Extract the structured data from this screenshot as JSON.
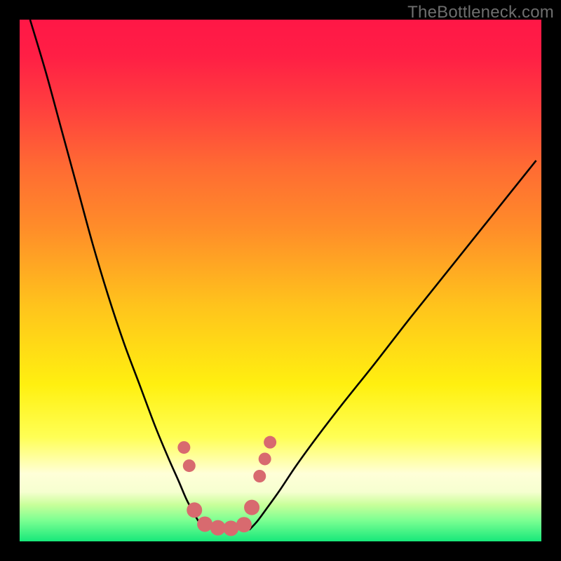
{
  "watermark": {
    "text": "TheBottleneck.com"
  },
  "gradient_stops": [
    {
      "offset": 0.0,
      "color": "#ff1746"
    },
    {
      "offset": 0.07,
      "color": "#ff1f45"
    },
    {
      "offset": 0.16,
      "color": "#ff3c3f"
    },
    {
      "offset": 0.28,
      "color": "#ff6a33"
    },
    {
      "offset": 0.4,
      "color": "#ff8d29"
    },
    {
      "offset": 0.55,
      "color": "#ffc41c"
    },
    {
      "offset": 0.7,
      "color": "#fff010"
    },
    {
      "offset": 0.8,
      "color": "#ffff55"
    },
    {
      "offset": 0.87,
      "color": "#ffffd8"
    },
    {
      "offset": 0.905,
      "color": "#f6ffd0"
    },
    {
      "offset": 0.93,
      "color": "#c8ff9a"
    },
    {
      "offset": 0.96,
      "color": "#7bff92"
    },
    {
      "offset": 1.0,
      "color": "#17e87a"
    }
  ],
  "chart_data": {
    "type": "line",
    "title": "",
    "xlabel": "",
    "ylabel": "",
    "xlim": [
      0,
      100
    ],
    "ylim": [
      0,
      100
    ],
    "series": [
      {
        "name": "left-curve",
        "x": [
          2,
          5,
          8,
          11,
          14,
          17,
          20,
          23,
          26,
          28.5,
          30.5,
          32,
          33.5,
          34.5,
          35.5
        ],
        "y": [
          100,
          90,
          79,
          68,
          57,
          47,
          38,
          30,
          22,
          16,
          11.5,
          8,
          5.2,
          3.5,
          2.2
        ]
      },
      {
        "name": "right-curve",
        "x": [
          44,
          45.5,
          47.5,
          50,
          53,
          57,
          62,
          68,
          75,
          83,
          91,
          99
        ],
        "y": [
          2.2,
          3.8,
          6.5,
          10,
          14.5,
          20,
          26.5,
          34,
          43,
          53,
          63,
          73
        ]
      },
      {
        "name": "markers",
        "type": "scatter",
        "color": "#d86a6f",
        "points": [
          {
            "x": 31.5,
            "y": 18.0,
            "r": 9
          },
          {
            "x": 32.5,
            "y": 14.5,
            "r": 9
          },
          {
            "x": 33.5,
            "y": 6.0,
            "r": 11
          },
          {
            "x": 35.5,
            "y": 3.3,
            "r": 11
          },
          {
            "x": 38.0,
            "y": 2.6,
            "r": 11
          },
          {
            "x": 40.5,
            "y": 2.5,
            "r": 11
          },
          {
            "x": 43.0,
            "y": 3.2,
            "r": 11
          },
          {
            "x": 44.5,
            "y": 6.5,
            "r": 11
          },
          {
            "x": 46.0,
            "y": 12.5,
            "r": 9
          },
          {
            "x": 47.0,
            "y": 15.8,
            "r": 9
          },
          {
            "x": 48.0,
            "y": 19.0,
            "r": 9
          }
        ]
      }
    ]
  }
}
